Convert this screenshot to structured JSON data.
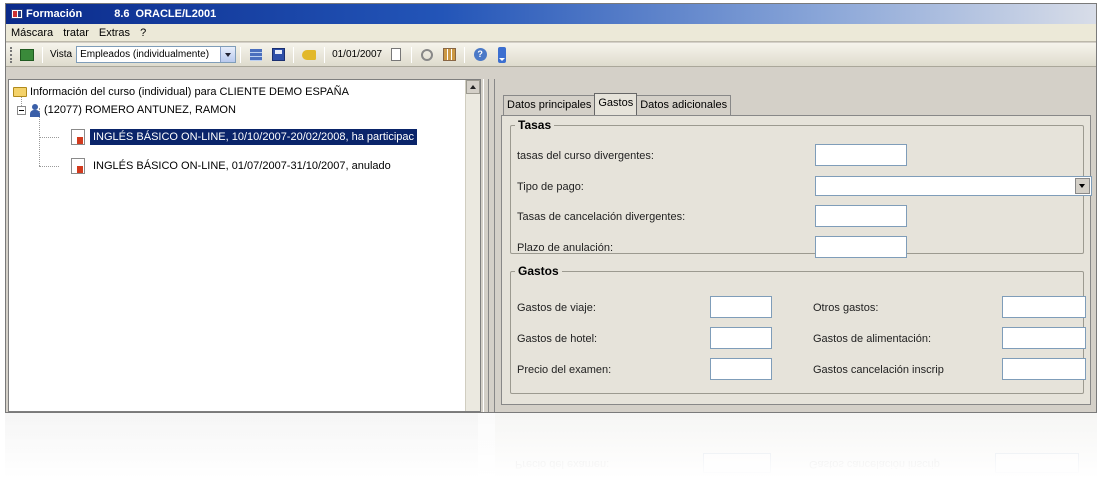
{
  "window": {
    "app_name": "Formación",
    "version": "8.6",
    "server": "ORACLE/L2001"
  },
  "menu": [
    "Máscara",
    "tratar",
    "Extras",
    "?"
  ],
  "toolbar": {
    "vista_label": "Vista",
    "vista_value": "Empleados (individualmente)",
    "date": "01/01/2007",
    "icons": [
      "exit-icon",
      "grid-icon",
      "save-icon",
      "key-icon",
      "document-icon",
      "cut-icon",
      "table-icon",
      "help-icon",
      "more-icon"
    ]
  },
  "tree": {
    "root": "Información del curso (individual) para CLIENTE DEMO ESPAÑA",
    "employee": "(12077) ROMERO ANTUNEZ, RAMON",
    "courses": [
      {
        "label": "INGLÉS BÁSICO ON-LINE, 10/10/2007-20/02/2008, ha participac",
        "selected": true
      },
      {
        "label": "INGLÉS BÁSICO ON-LINE, 01/07/2007-31/10/2007, anulado",
        "selected": false
      }
    ]
  },
  "tabs": [
    {
      "label": "Datos principales",
      "active": false
    },
    {
      "label": "Gastos",
      "active": true
    },
    {
      "label": "Datos adicionales",
      "active": false
    }
  ],
  "tasas": {
    "legend": "Tasas",
    "fields": {
      "tasas_curso": {
        "label": "tasas del curso divergentes:",
        "value": ""
      },
      "tipo_pago": {
        "label": "Tipo de pago:",
        "value": ""
      },
      "tasas_cancelacion": {
        "label": "Tasas de cancelación divergentes:",
        "value": ""
      },
      "plazo_anulacion": {
        "label": "Plazo de anulación:",
        "value": ""
      }
    }
  },
  "gastos": {
    "legend": "Gastos",
    "fields": {
      "viaje": {
        "label": "Gastos de viaje:",
        "value": ""
      },
      "hotel": {
        "label": "Gastos de hotel:",
        "value": ""
      },
      "examen": {
        "label": "Precio del examen:",
        "value": ""
      },
      "otros": {
        "label": "Otros gastos:",
        "value": ""
      },
      "alimentacion": {
        "label": "Gastos de alimentación:",
        "value": ""
      },
      "cancelacion_inscrip": {
        "label": "Gastos cancelación inscrip",
        "value": ""
      }
    }
  },
  "colors": {
    "title_bar": "#0a2a8a",
    "selection": "#0a246a",
    "panel_bg": "#d4d0c8",
    "tab_page_bg": "#e6e3da"
  }
}
